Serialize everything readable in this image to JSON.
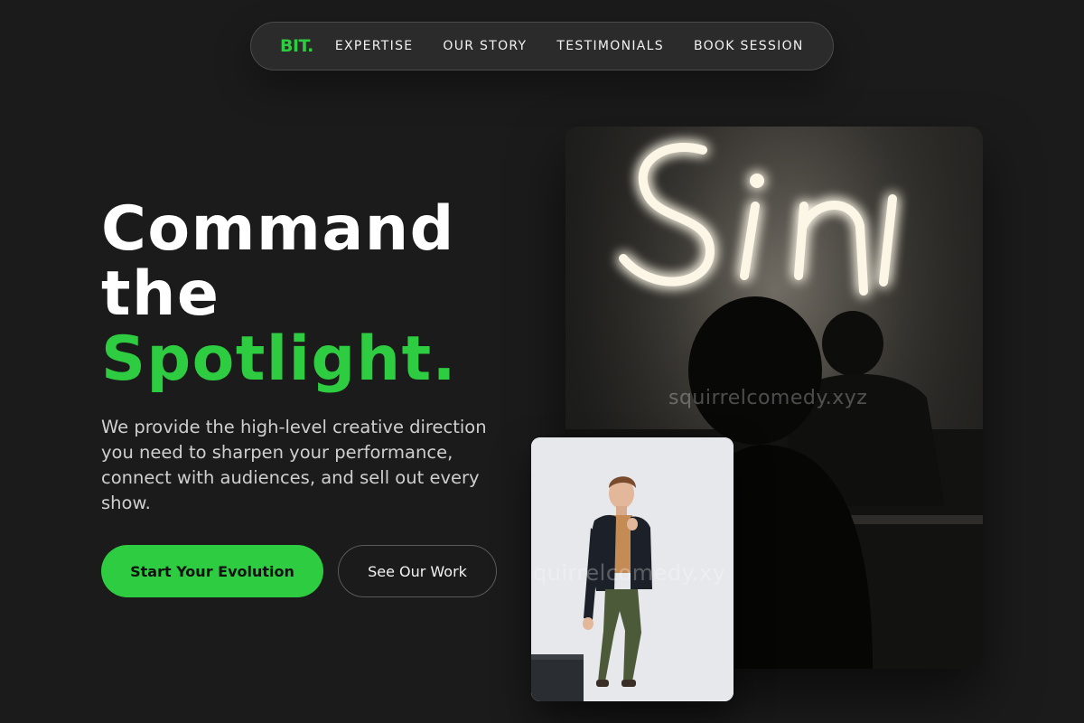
{
  "nav": {
    "logo": "BIT.",
    "links": [
      "EXPERTISE",
      "OUR STORY",
      "TESTIMONIALS",
      "BOOK SESSION"
    ]
  },
  "hero": {
    "headline_line1": "Command",
    "headline_line2": "the",
    "headline_accent": "Spotlight.",
    "subtitle": "We provide the high-level creative direction you need to sharpen your performance, connect with audiences, and sell out every show.",
    "primary_cta": "Start Your Evolution",
    "secondary_cta": "See Our Work"
  },
  "images": {
    "main_watermark": "squirrelcomedy.xyz",
    "small_watermark": "quirrelcomedy.xy"
  },
  "colors": {
    "background": "#1b1b1b",
    "accent": "#2ecc40",
    "text": "#ffffff",
    "muted_text": "#cfcfcf"
  }
}
